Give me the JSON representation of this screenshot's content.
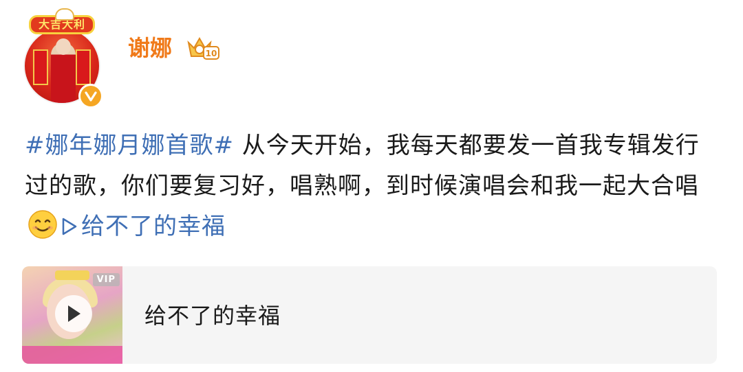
{
  "author": {
    "name": "谢娜",
    "avatar_frame_text": "大吉大利",
    "verified_icon": "verified-v-icon",
    "level_icon": "crown-level-icon",
    "level_number": "10",
    "colors": {
      "name": "#f07a1a",
      "verified": "#f5a623"
    }
  },
  "post": {
    "topic": "#娜年娜月娜首歌#",
    "text_part1": " 从今天开始，我每天都要发一首我专辑发行过的歌，你们要复习好，唱熟啊，到时候演唱会和我一起大合唱",
    "emoji": "smile-emoji",
    "music_link_label": "给不了的幸福",
    "music_link_icon": "play-triangle-icon",
    "link_color": "#3f6fb5"
  },
  "media_card": {
    "title": "给不了的幸福",
    "vip_label": "VIP",
    "play_icon": "play-icon",
    "background": "#f5f5f5"
  }
}
